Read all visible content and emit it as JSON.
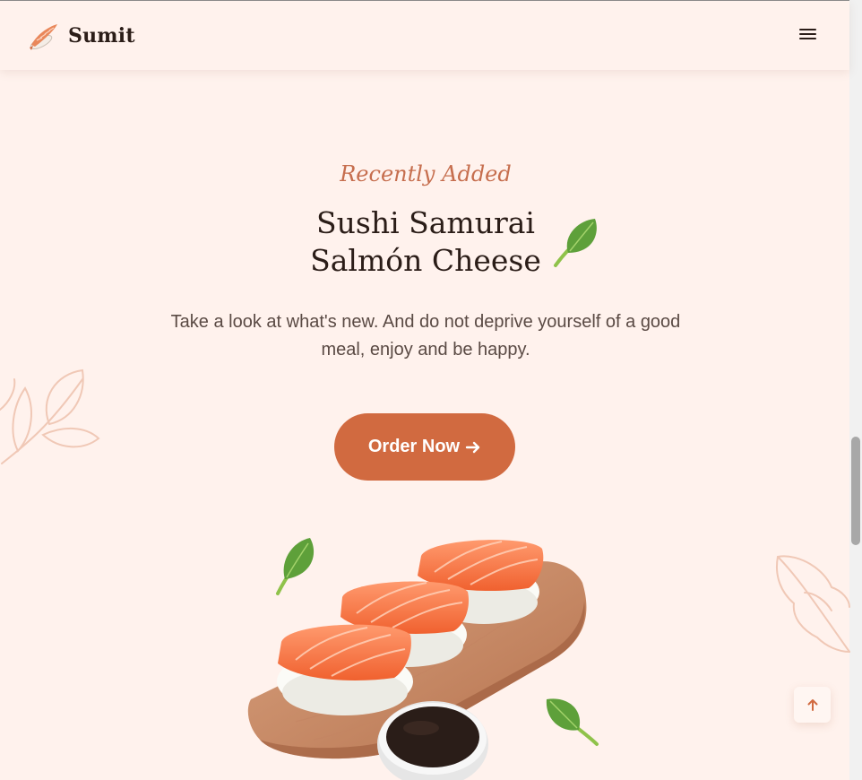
{
  "header": {
    "brand": "Sumit",
    "logo_icon": "sushi-logo-icon",
    "menu_icon": "hamburger-menu-icon"
  },
  "hero": {
    "subtitle": "Recently Added",
    "title_line1": "Sushi Samurai",
    "title_line2": "Salmón Cheese",
    "description": "Take a look at what's new. And do not deprive yourself of a good meal, enjoy and be happy.",
    "cta_label": "Order Now",
    "cta_icon": "arrow-right-icon"
  },
  "scroll_up_icon": "arrow-up-icon",
  "colors": {
    "background": "#fff2ed",
    "accent": "#d16a40",
    "subtitle": "#c66e4e",
    "text_dark": "#2b1d18",
    "text_body": "#5a4a44",
    "leaf_outline": "#f0c8b6"
  }
}
